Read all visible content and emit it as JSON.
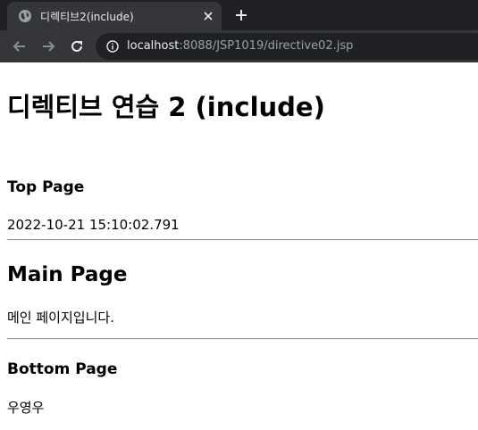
{
  "browser": {
    "tab_title": "디렉티브2(include)",
    "url_host": "localhost",
    "url_rest": ":8088/JSP1019/directive02.jsp"
  },
  "page": {
    "heading": "디렉티브 연습 2 (include)",
    "top": {
      "title": "Top Page",
      "text": "2022-10-21 15:10:02.791"
    },
    "main": {
      "title": "Main Page",
      "text": "메인 페이지입니다."
    },
    "bottom": {
      "title": "Bottom Page",
      "text": "우영우"
    }
  }
}
